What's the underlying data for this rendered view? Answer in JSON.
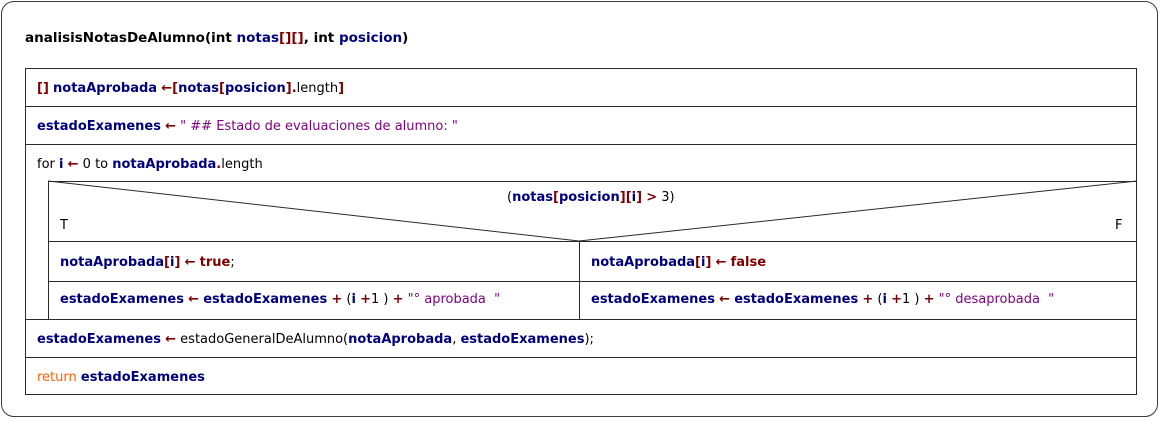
{
  "diagram": {
    "title": [
      {
        "t": "analisisNotasDeAlumno",
        "c": "tb"
      },
      {
        "t": "(",
        "c": "tb"
      },
      {
        "t": "int ",
        "c": "tb"
      },
      {
        "t": "notas",
        "c": "v"
      },
      {
        "t": "[][]",
        "c": "br"
      },
      {
        "t": ", ",
        "c": "tb"
      },
      {
        "t": "int ",
        "c": "tb"
      },
      {
        "t": "posicion",
        "c": "v"
      },
      {
        "t": ")",
        "c": "tb"
      }
    ],
    "rows": [
      [
        {
          "t": "[]",
          "c": "br"
        },
        {
          "t": " ",
          "c": "p"
        },
        {
          "t": "notaAprobada",
          "c": "v"
        },
        {
          "t": " ",
          "c": "p"
        },
        {
          "t": "←",
          "c": "op"
        },
        {
          "t": "[",
          "c": "br"
        },
        {
          "t": "notas",
          "c": "v"
        },
        {
          "t": "[",
          "c": "br"
        },
        {
          "t": "posicion",
          "c": "v"
        },
        {
          "t": "]",
          "c": "br"
        },
        {
          "t": ".",
          "c": "op"
        },
        {
          "t": "length",
          "c": "fn"
        },
        {
          "t": "]",
          "c": "br"
        }
      ],
      [
        {
          "t": "estadoExamenes",
          "c": "v"
        },
        {
          "t": " ",
          "c": "p"
        },
        {
          "t": "←",
          "c": "op"
        },
        {
          "t": " \" ## Estado de evaluaciones de alumno: \"",
          "c": "str"
        }
      ],
      [
        {
          "t": "for ",
          "c": "kw"
        },
        {
          "t": "i",
          "c": "v"
        },
        {
          "t": " ",
          "c": "p"
        },
        {
          "t": "←",
          "c": "op"
        },
        {
          "t": " 0 to ",
          "c": "kw"
        },
        {
          "t": "notaAprobada",
          "c": "v"
        },
        {
          "t": ".",
          "c": "op"
        },
        {
          "t": "length",
          "c": "fn"
        }
      ]
    ],
    "condition": [
      {
        "t": "(",
        "c": "p"
      },
      {
        "t": "notas",
        "c": "v"
      },
      {
        "t": "[",
        "c": "br"
      },
      {
        "t": "posicion",
        "c": "v"
      },
      {
        "t": "]",
        "c": "br"
      },
      {
        "t": "[",
        "c": "br"
      },
      {
        "t": "i",
        "c": "v"
      },
      {
        "t": "]",
        "c": "br"
      },
      {
        "t": " ",
        "c": "p"
      },
      {
        "t": ">",
        "c": "op"
      },
      {
        "t": " 3)",
        "c": "p"
      }
    ],
    "true_label": "T",
    "false_label": "F",
    "true_branch": [
      [
        {
          "t": "notaAprobada",
          "c": "v"
        },
        {
          "t": "[",
          "c": "br"
        },
        {
          "t": "i",
          "c": "v"
        },
        {
          "t": "]",
          "c": "br"
        },
        {
          "t": " ",
          "c": "p"
        },
        {
          "t": "←",
          "c": "op"
        },
        {
          "t": " ",
          "c": "p"
        },
        {
          "t": "true",
          "c": "bool"
        },
        {
          "t": ";",
          "c": "p"
        }
      ],
      [
        {
          "t": "estadoExamenes",
          "c": "v"
        },
        {
          "t": " ",
          "c": "p"
        },
        {
          "t": "←",
          "c": "op"
        },
        {
          "t": " ",
          "c": "p"
        },
        {
          "t": "estadoExamenes",
          "c": "v"
        },
        {
          "t": " ",
          "c": "p"
        },
        {
          "t": "+",
          "c": "op"
        },
        {
          "t": " (",
          "c": "p"
        },
        {
          "t": "i",
          "c": "v"
        },
        {
          "t": " ",
          "c": "p"
        },
        {
          "t": "+",
          "c": "op"
        },
        {
          "t": "1 ) ",
          "c": "p"
        },
        {
          "t": "+",
          "c": "op"
        },
        {
          "t": " \"° aprobada  \"",
          "c": "str"
        }
      ]
    ],
    "false_branch": [
      [
        {
          "t": "notaAprobada",
          "c": "v"
        },
        {
          "t": "[",
          "c": "br"
        },
        {
          "t": "i",
          "c": "v"
        },
        {
          "t": "]",
          "c": "br"
        },
        {
          "t": " ",
          "c": "p"
        },
        {
          "t": "←",
          "c": "op"
        },
        {
          "t": " ",
          "c": "p"
        },
        {
          "t": "false",
          "c": "bool"
        }
      ],
      [
        {
          "t": "estadoExamenes",
          "c": "v"
        },
        {
          "t": " ",
          "c": "p"
        },
        {
          "t": "←",
          "c": "op"
        },
        {
          "t": " ",
          "c": "p"
        },
        {
          "t": "estadoExamenes",
          "c": "v"
        },
        {
          "t": " ",
          "c": "p"
        },
        {
          "t": "+",
          "c": "op"
        },
        {
          "t": " (",
          "c": "p"
        },
        {
          "t": "i",
          "c": "v"
        },
        {
          "t": " ",
          "c": "p"
        },
        {
          "t": "+",
          "c": "op"
        },
        {
          "t": "1 ) ",
          "c": "p"
        },
        {
          "t": "+",
          "c": "op"
        },
        {
          "t": " \"° desaprobada  \"",
          "c": "str"
        }
      ]
    ],
    "after_rows": [
      [
        {
          "t": "estadoExamenes",
          "c": "v"
        },
        {
          "t": " ",
          "c": "p"
        },
        {
          "t": "←",
          "c": "op"
        },
        {
          "t": " estadoGeneralDeAlumno(",
          "c": "fn"
        },
        {
          "t": "notaAprobada",
          "c": "v"
        },
        {
          "t": ", ",
          "c": "p"
        },
        {
          "t": "estadoExamenes",
          "c": "v"
        },
        {
          "t": ");",
          "c": "p"
        }
      ],
      [
        {
          "t": "return",
          "c": "ret"
        },
        {
          "t": " ",
          "c": "p"
        },
        {
          "t": "estadoExamenes",
          "c": "v"
        }
      ]
    ]
  }
}
